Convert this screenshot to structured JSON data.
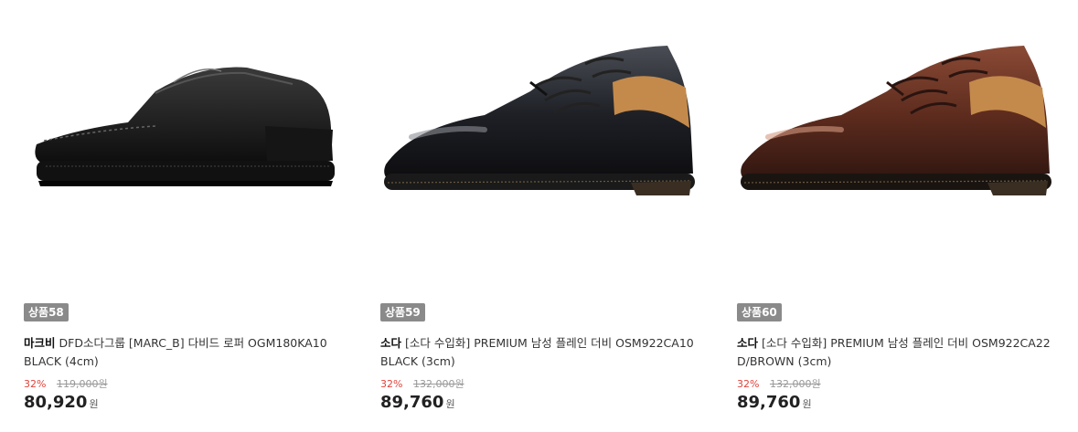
{
  "products": [
    {
      "badge": "상품58",
      "brand": "마크비",
      "name_line1": "DFD소다그룹 [MARC_B] 다비드 로퍼 OGM180KA10",
      "name_line2": "BLACK (4cm)",
      "discount": "32%",
      "original_price": "119,000원",
      "price": "80,920",
      "currency": "원",
      "color": "black"
    },
    {
      "badge": "상품59",
      "brand": "소다",
      "name_line1": "[소다 수입화] PREMIUM 남성 플레인 더비 OSM922CA10",
      "name_line2": "BLACK (3cm)",
      "discount": "32%",
      "original_price": "132,000원",
      "price": "89,760",
      "currency": "원",
      "color": "black"
    },
    {
      "badge": "상품60",
      "brand": "소다",
      "name_line1": "[소다 수입화] PREMIUM 남성 플레인 더비 OSM922CA22",
      "name_line2": "D/BROWN (3cm)",
      "discount": "32%",
      "original_price": "132,000원",
      "price": "89,760",
      "currency": "원",
      "color": "brown"
    }
  ],
  "colors": {
    "discount": "#e0433b",
    "badge_bg": "#8a8a8a"
  }
}
